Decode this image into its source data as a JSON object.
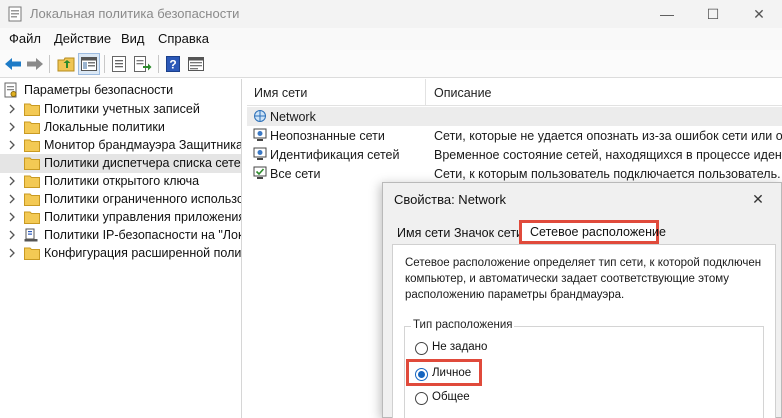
{
  "window": {
    "title": "Локальная политика безопасности",
    "controls": {
      "minimize": "—",
      "maximize": "☐",
      "close": "✕"
    }
  },
  "menu": [
    "Файл",
    "Действие",
    "Вид",
    "Справка"
  ],
  "toolbar_icons": [
    "back-icon",
    "forward-icon",
    "up-folder-icon",
    "show-tree-icon",
    "properties-icon",
    "export-list-icon",
    "help-icon",
    "console-icon"
  ],
  "tree": {
    "root": "Параметры безопасности",
    "items": [
      {
        "label": "Политики учетных записей"
      },
      {
        "label": "Локальные политики"
      },
      {
        "label": "Монитор брандмауэра Защитника W"
      },
      {
        "label": "Политики диспетчера списка сетей"
      },
      {
        "label": "Политики открытого ключа"
      },
      {
        "label": "Политики ограниченного использо"
      },
      {
        "label": "Политики управления приложения"
      },
      {
        "label": "Политики IP-безопасности на \"Лока"
      },
      {
        "label": "Конфигурация расширенной полит"
      }
    ]
  },
  "list": {
    "columns": [
      "Имя сети",
      "Описание"
    ],
    "rows": [
      {
        "name": "Network",
        "description": ""
      },
      {
        "name": "Неопознанные сети",
        "description": "Сети, которые не удается опознать из-за ошибок сети или отсут"
      },
      {
        "name": "Идентификация сетей",
        "description": "Временное состояние сетей, находящихся в процессе идентиф"
      },
      {
        "name": "Все сети",
        "description": "Сети, к которым пользователь подключается пользователь."
      }
    ]
  },
  "dialog": {
    "title": "Свойства: Network",
    "close": "✕",
    "tabs": [
      "Имя сети",
      "Значок сети",
      "Сетевое расположение"
    ],
    "description_lines": [
      "Сетевое расположение определяет тип сети, к которой подключен",
      "компьютер, и автоматически задает соответствующие этому",
      "расположению параметры брандмауэра."
    ],
    "group_label": "Тип расположения",
    "options": [
      "Не задано",
      "Личное",
      "Общее"
    ],
    "selected_option": "Личное"
  },
  "colors": {
    "highlight": "#e04a3b",
    "radio_accent": "#1565c0",
    "folder": "#f0c553"
  }
}
